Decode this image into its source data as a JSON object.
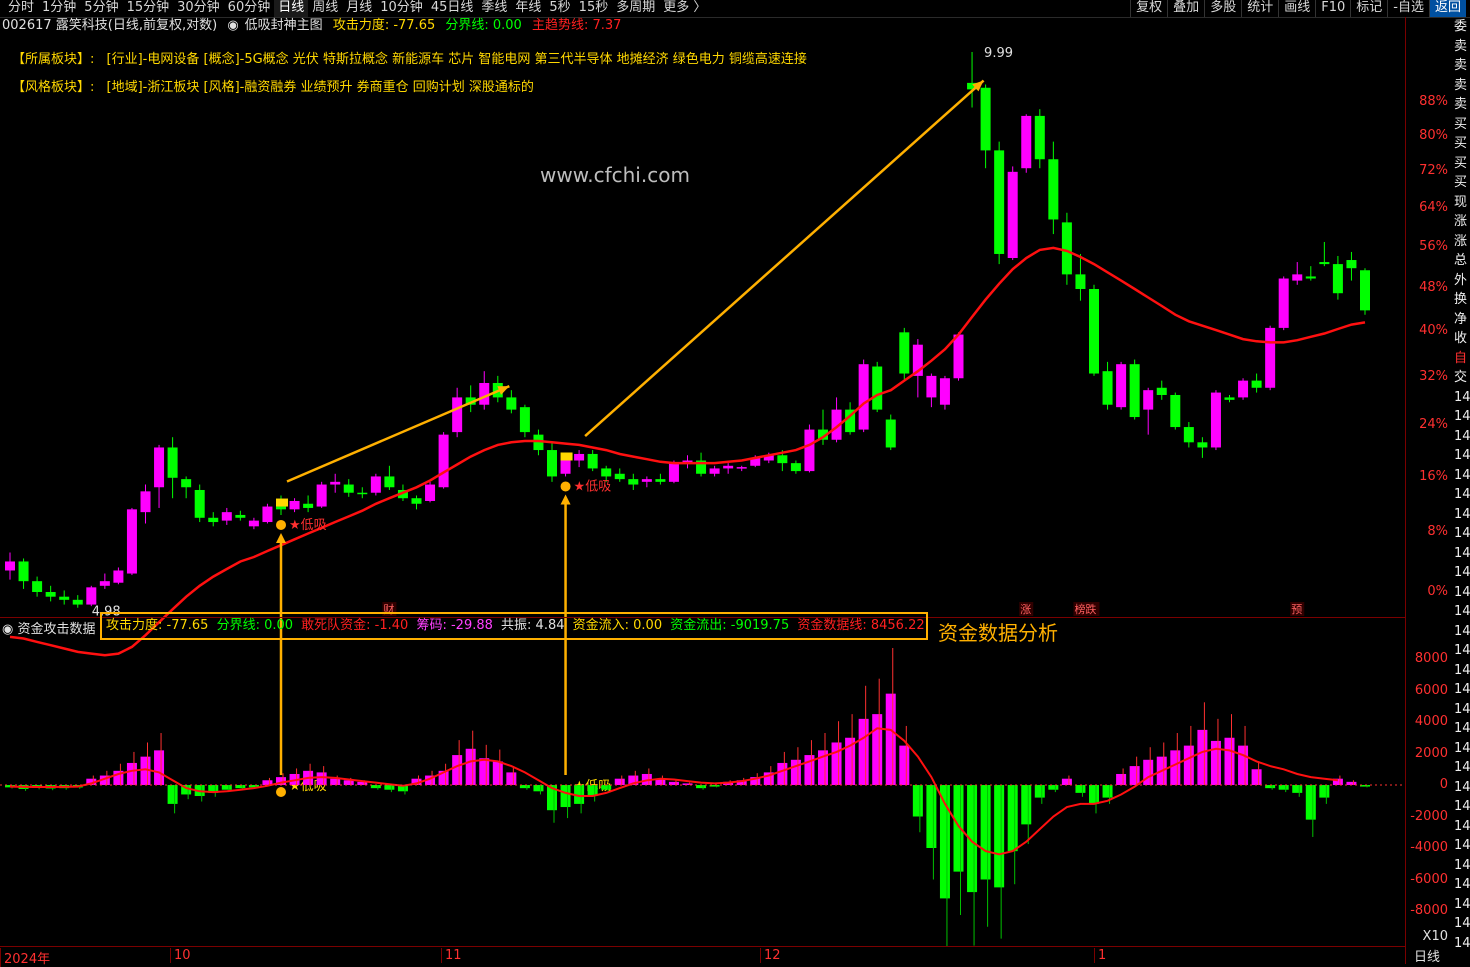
{
  "menu": {
    "periods": [
      "分时",
      "1分钟",
      "5分钟",
      "15分钟",
      "30分钟",
      "60分钟",
      "日线",
      "周线",
      "月线",
      "10分钟",
      "45日线",
      "季线",
      "年线",
      "5秒",
      "15秒",
      "多周期",
      "更多 〉"
    ],
    "active_period": "日线",
    "right": [
      "复权",
      "叠加",
      "多股",
      "统计",
      "画线",
      "F10",
      "标记",
      "-自选",
      "返回"
    ]
  },
  "title": {
    "stock": "002617 露笑科技(日线,前复权,对数)",
    "indicator": "低吸封神主图",
    "attack": "攻击力度: -77.65",
    "boundary": "分界线: 0.00",
    "trend": "主趋势线: 7.37"
  },
  "sectors": {
    "industry_label": "【所属板块】:",
    "industry": "[行业]-电网设备 [概念]-5G概念 光伏 特斯拉概念 新能源车 芯片 智能电网 第三代半导体 地摊经济 绿色电力 铜缆高速连接",
    "style_label": "【风格板块】:",
    "style": "[地域]-浙江板块 [风格]-融资融券 业绩预升 券商重仓 回购计划 深股通标的"
  },
  "watermark": "www.cfchi.com",
  "price_labels": {
    "high": "9.99",
    "low": "4.98"
  },
  "signal_text": "★低吸",
  "event_markers": [
    "财",
    "涨",
    "榜跌",
    "预"
  ],
  "right_axis_pct": [
    "88%",
    "80%",
    "72%",
    "64%",
    "56%",
    "48%",
    "40%",
    "32%",
    "24%",
    "16%",
    "8%",
    "0%"
  ],
  "sub_axis": [
    "8000",
    "6000",
    "4000",
    "2000",
    "0",
    "-2000",
    "-4000",
    "-6000",
    "-8000"
  ],
  "sub_panel": {
    "name": "资金攻击数据",
    "attack": "攻击力度: -77.65",
    "boundary": "分界线: 0.00",
    "dare": "敢死队资金: -1.40",
    "chips": "筹码: -29.88",
    "resonance": "共振: 4.84",
    "inflow": "资金流入: 0.00",
    "outflow": "资金流出: -9019.75",
    "dataline": "资金数据线: 8456.22",
    "title": "资金数据分析",
    "scale": "X10"
  },
  "right_strip": [
    "委",
    "卖",
    "卖",
    "卖",
    "卖",
    "买",
    "买",
    "买",
    "买",
    "现",
    "涨",
    "涨",
    "总",
    "外",
    "换",
    "净",
    "收",
    "自",
    "交",
    "14",
    "14",
    "14",
    "14",
    "14",
    "14",
    "14",
    "14",
    "14",
    "14",
    "14",
    "14",
    "14",
    "14",
    "14",
    "14",
    "14",
    "14",
    "14",
    "14",
    "14",
    "14",
    "14",
    "14",
    "14",
    "14",
    "14",
    "14",
    "14"
  ],
  "date_axis": [
    "2024年",
    "10",
    "11",
    "12",
    "1"
  ],
  "bottom_right": "日线",
  "colors": {
    "up": "#ff00ff",
    "down": "#00ff00",
    "trend": "#ff1010",
    "arrow": "#ffb000",
    "signal": "#ffd800"
  },
  "chart_data": {
    "type": "candlestick",
    "candles": [
      [
        5.12,
        5.24,
        5.06,
        5.18
      ],
      [
        5.18,
        5.2,
        5.0,
        5.05
      ],
      [
        5.05,
        5.08,
        4.95,
        4.98
      ],
      [
        4.98,
        5.02,
        4.92,
        4.95
      ],
      [
        4.95,
        4.99,
        4.9,
        4.93
      ],
      [
        4.93,
        4.96,
        4.88,
        4.9
      ],
      [
        4.9,
        5.02,
        4.89,
        5.01
      ],
      [
        5.02,
        5.1,
        5.0,
        5.05
      ],
      [
        5.04,
        5.14,
        5.03,
        5.12
      ],
      [
        5.1,
        5.55,
        5.09,
        5.54
      ],
      [
        5.52,
        5.72,
        5.44,
        5.67
      ],
      [
        5.7,
        6.02,
        5.55,
        6.0
      ],
      [
        6.0,
        6.08,
        5.62,
        5.77
      ],
      [
        5.76,
        5.78,
        5.62,
        5.7
      ],
      [
        5.68,
        5.72,
        5.45,
        5.48
      ],
      [
        5.48,
        5.52,
        5.42,
        5.45
      ],
      [
        5.46,
        5.55,
        5.43,
        5.52
      ],
      [
        5.5,
        5.53,
        5.46,
        5.48
      ],
      [
        5.42,
        5.48,
        5.4,
        5.46
      ],
      [
        5.45,
        5.58,
        5.44,
        5.56
      ],
      [
        5.56,
        5.64,
        5.5,
        5.54
      ],
      [
        5.54,
        5.62,
        5.52,
        5.6
      ],
      [
        5.58,
        5.64,
        5.52,
        5.55
      ],
      [
        5.56,
        5.74,
        5.55,
        5.72
      ],
      [
        5.72,
        5.8,
        5.66,
        5.74
      ],
      [
        5.72,
        5.76,
        5.63,
        5.66
      ],
      [
        5.66,
        5.7,
        5.62,
        5.65
      ],
      [
        5.66,
        5.8,
        5.64,
        5.78
      ],
      [
        5.78,
        5.86,
        5.68,
        5.7
      ],
      [
        5.68,
        5.72,
        5.6,
        5.62
      ],
      [
        5.62,
        5.64,
        5.54,
        5.58
      ],
      [
        5.6,
        5.74,
        5.59,
        5.72
      ],
      [
        5.7,
        6.12,
        5.69,
        6.1
      ],
      [
        6.12,
        6.48,
        6.08,
        6.4
      ],
      [
        6.4,
        6.5,
        6.28,
        6.34
      ],
      [
        6.34,
        6.62,
        6.3,
        6.52
      ],
      [
        6.52,
        6.58,
        6.36,
        6.4
      ],
      [
        6.4,
        6.46,
        6.27,
        6.3
      ],
      [
        6.32,
        6.34,
        6.08,
        6.12
      ],
      [
        6.1,
        6.14,
        5.94,
        5.98
      ],
      [
        5.98,
        6.04,
        5.74,
        5.78
      ],
      [
        5.8,
        5.92,
        5.78,
        5.9
      ],
      [
        5.9,
        5.98,
        5.85,
        5.95
      ],
      [
        5.95,
        5.98,
        5.82,
        5.84
      ],
      [
        5.84,
        5.86,
        5.74,
        5.78
      ],
      [
        5.8,
        5.84,
        5.74,
        5.76
      ],
      [
        5.76,
        5.8,
        5.68,
        5.72
      ],
      [
        5.74,
        5.78,
        5.7,
        5.76
      ],
      [
        5.76,
        5.8,
        5.72,
        5.74
      ],
      [
        5.74,
        5.9,
        5.73,
        5.88
      ],
      [
        5.88,
        5.94,
        5.84,
        5.9
      ],
      [
        5.9,
        5.96,
        5.78,
        5.8
      ],
      [
        5.8,
        5.86,
        5.78,
        5.84
      ],
      [
        5.84,
        5.88,
        5.8,
        5.86
      ],
      [
        5.84,
        5.86,
        5.82,
        5.85
      ],
      [
        5.86,
        5.94,
        5.85,
        5.92
      ],
      [
        5.9,
        5.96,
        5.88,
        5.94
      ],
      [
        5.94,
        5.98,
        5.82,
        5.88
      ],
      [
        5.88,
        5.9,
        5.8,
        5.82
      ],
      [
        5.82,
        6.18,
        5.81,
        6.14
      ],
      [
        6.14,
        6.3,
        6.02,
        6.06
      ],
      [
        6.06,
        6.4,
        6.04,
        6.3
      ],
      [
        6.3,
        6.36,
        6.1,
        6.12
      ],
      [
        6.14,
        6.72,
        6.12,
        6.68
      ],
      [
        6.66,
        6.7,
        6.28,
        6.3
      ],
      [
        6.22,
        6.26,
        5.98,
        6.0
      ],
      [
        6.96,
        7.0,
        6.55,
        6.6
      ],
      [
        6.58,
        6.9,
        6.4,
        6.85
      ],
      [
        6.4,
        6.6,
        6.32,
        6.58
      ],
      [
        6.34,
        6.58,
        6.3,
        6.56
      ],
      [
        6.56,
        6.96,
        6.54,
        6.94
      ],
      [
        9.6,
        9.99,
        9.3,
        9.52
      ],
      [
        9.54,
        9.58,
        8.6,
        8.8
      ],
      [
        8.8,
        8.9,
        7.6,
        7.7
      ],
      [
        7.66,
        8.62,
        7.64,
        8.56
      ],
      [
        8.6,
        9.22,
        8.55,
        9.2
      ],
      [
        9.2,
        9.28,
        8.6,
        8.7
      ],
      [
        8.7,
        8.9,
        7.9,
        8.05
      ],
      [
        8.02,
        8.12,
        7.4,
        7.5
      ],
      [
        7.5,
        7.7,
        7.25,
        7.36
      ],
      [
        7.36,
        7.4,
        6.58,
        6.6
      ],
      [
        6.62,
        6.7,
        6.3,
        6.34
      ],
      [
        6.32,
        6.7,
        6.3,
        6.68
      ],
      [
        6.68,
        6.72,
        6.22,
        6.24
      ],
      [
        6.3,
        6.48,
        6.1,
        6.46
      ],
      [
        6.48,
        6.54,
        6.38,
        6.42
      ],
      [
        6.42,
        6.44,
        6.14,
        6.16
      ],
      [
        6.16,
        6.2,
        6.0,
        6.04
      ],
      [
        6.04,
        6.08,
        5.92,
        6.0
      ],
      [
        6.0,
        6.46,
        5.98,
        6.44
      ],
      [
        6.4,
        6.42,
        6.36,
        6.38
      ],
      [
        6.4,
        6.56,
        6.38,
        6.54
      ],
      [
        6.54,
        6.6,
        6.44,
        6.48
      ],
      [
        6.48,
        7.02,
        6.46,
        7.0
      ],
      [
        7.0,
        7.48,
        6.98,
        7.46
      ],
      [
        7.44,
        7.62,
        7.4,
        7.5
      ],
      [
        7.48,
        7.58,
        7.44,
        7.46
      ],
      [
        7.62,
        7.82,
        7.58,
        7.6
      ],
      [
        7.6,
        7.68,
        7.26,
        7.32
      ],
      [
        7.64,
        7.72,
        7.44,
        7.56
      ],
      [
        7.54,
        7.56,
        7.12,
        7.16
      ]
    ],
    "trend_line": [
      4.7,
      4.69,
      4.67,
      4.65,
      4.63,
      4.61,
      4.6,
      4.59,
      4.6,
      4.64,
      4.71,
      4.79,
      4.87,
      4.95,
      5.02,
      5.08,
      5.13,
      5.18,
      5.21,
      5.25,
      5.29,
      5.33,
      5.37,
      5.41,
      5.45,
      5.49,
      5.53,
      5.58,
      5.62,
      5.66,
      5.7,
      5.75,
      5.81,
      5.87,
      5.93,
      5.98,
      6.02,
      6.04,
      6.05,
      6.05,
      6.04,
      6.03,
      6.02,
      6.0,
      5.98,
      5.95,
      5.93,
      5.91,
      5.89,
      5.88,
      5.88,
      5.88,
      5.88,
      5.89,
      5.9,
      5.92,
      5.94,
      5.96,
      5.98,
      6.02,
      6.08,
      6.16,
      6.25,
      6.35,
      6.42,
      6.46,
      6.54,
      6.62,
      6.71,
      6.81,
      6.94,
      7.1,
      7.26,
      7.41,
      7.55,
      7.66,
      7.74,
      7.76,
      7.73,
      7.67,
      7.6,
      7.52,
      7.44,
      7.36,
      7.28,
      7.2,
      7.12,
      7.06,
      7.02,
      6.98,
      6.94,
      6.9,
      6.88,
      6.87,
      6.87,
      6.89,
      6.92,
      6.95,
      6.99,
      7.03,
      7.05
    ],
    "signals": [
      20,
      41
    ],
    "sub_bars": [
      -150,
      -250,
      -180,
      -220,
      -200,
      -160,
      400,
      600,
      900,
      1400,
      1800,
      2200,
      -1200,
      -600,
      -700,
      -500,
      -300,
      -200,
      -150,
      300,
      500,
      700,
      900,
      800,
      400,
      300,
      200,
      -200,
      -300,
      -400,
      400,
      600,
      900,
      1900,
      2300,
      1700,
      1500,
      800,
      -200,
      -400,
      -1600,
      -1400,
      -1200,
      -700,
      -300,
      400,
      600,
      700,
      400,
      200,
      100,
      -200,
      -100,
      200,
      300,
      500,
      800,
      1400,
      1600,
      1900,
      2200,
      2700,
      3000,
      4200,
      4500,
      5800,
      2500,
      -2000,
      -4000,
      -7200,
      -5500,
      -6800,
      -6000,
      -6500,
      -4200,
      -2500,
      -800,
      -300,
      400,
      -500,
      -1200,
      -800,
      700,
      1200,
      1600,
      1800,
      2200,
      2500,
      3500,
      2800,
      3000,
      2500,
      1000,
      -200,
      -300,
      -500,
      -2200,
      -800,
      400,
      200,
      -100
    ],
    "sub_line": [
      -100,
      -120,
      -130,
      -130,
      -120,
      -100,
      100,
      400,
      700,
      900,
      1000,
      800,
      300,
      -200,
      -400,
      -450,
      -400,
      -300,
      -200,
      -50,
      150,
      300,
      450,
      500,
      450,
      350,
      250,
      150,
      50,
      -50,
      100,
      400,
      800,
      1200,
      1500,
      1600,
      1500,
      1200,
      800,
      300,
      -200,
      -500,
      -700,
      -700,
      -500,
      -200,
      100,
      300,
      400,
      350,
      250,
      150,
      100,
      150,
      250,
      400,
      600,
      900,
      1200,
      1500,
      1800,
      2100,
      2500,
      3000,
      3600,
      3500,
      2800,
      1800,
      500,
      -1200,
      -2600,
      -3600,
      -4200,
      -4400,
      -4200,
      -3600,
      -2800,
      -2000,
      -1400,
      -1200,
      -1200,
      -1000,
      -600,
      -100,
      500,
      900,
      1300,
      1700,
      2100,
      2300,
      2200,
      1900,
      1500,
      1200,
      1000,
      700,
      500,
      400,
      300
    ],
    "y_axis": "log"
  }
}
